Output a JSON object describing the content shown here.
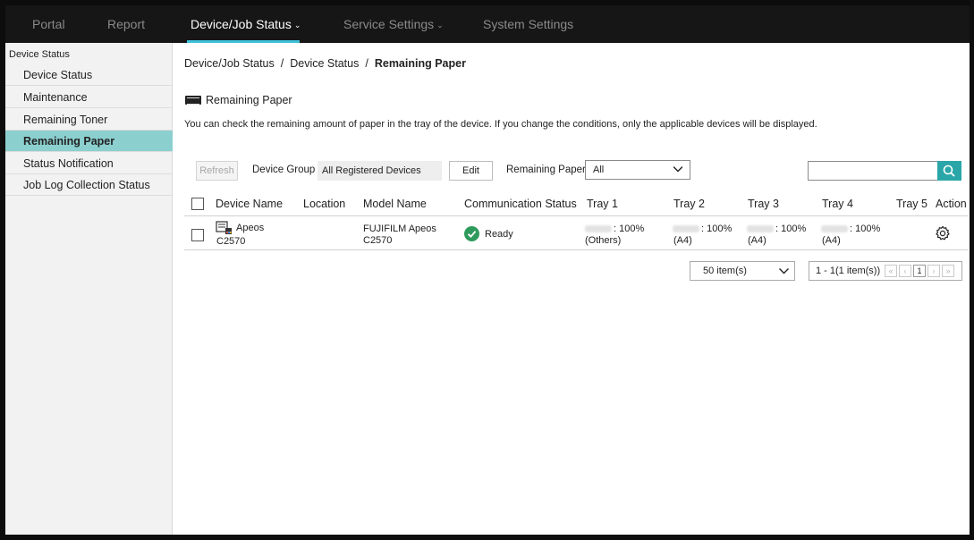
{
  "nav": {
    "items": [
      {
        "label": "Portal",
        "active": false
      },
      {
        "label": "Report",
        "active": false
      },
      {
        "label": "Device/Job Status",
        "active": true,
        "dropdown": true
      },
      {
        "label": "Service Settings",
        "active": false,
        "dropdown": true
      },
      {
        "label": "System Settings",
        "active": false
      }
    ]
  },
  "sidebar": {
    "group_label": "Device Status",
    "items": [
      {
        "label": "Device Status"
      },
      {
        "label": "Maintenance"
      },
      {
        "label": "Remaining Toner"
      },
      {
        "label": "Remaining Paper",
        "active": true
      },
      {
        "label": "Status Notification"
      },
      {
        "label": "Job Log Collection Status"
      }
    ]
  },
  "breadcrumb": {
    "part1": "Device/Job Status",
    "part2": "Device Status",
    "current": "Remaining Paper",
    "sep": "/"
  },
  "page": {
    "title": "Remaining Paper",
    "description": "You can check the remaining amount of paper in the tray of the device. If you change the conditions, only the applicable devices will be displayed."
  },
  "filter": {
    "refresh_label": "Refresh",
    "device_group_label": "Device Group",
    "device_group_value": "All Registered Devices",
    "edit_label": "Edit",
    "remaining_paper_label": "Remaining Paper",
    "remaining_paper_value": "All",
    "search_placeholder": ""
  },
  "table": {
    "headers": {
      "device_name": "Device Name",
      "location": "Location",
      "model_name": "Model Name",
      "comm_status": "Communication Status",
      "tray1": "Tray 1",
      "tray2": "Tray 2",
      "tray3": "Tray 3",
      "tray4": "Tray 4",
      "tray5": "Tray 5",
      "action": "Action"
    },
    "rows": [
      {
        "device_name_line1": "Apeos",
        "device_name_line2": "C2570",
        "location": "",
        "model_line1": "FUJIFILM Apeos",
        "model_line2": "C2570",
        "status": "Ready",
        "tray1_pct": ": 100%",
        "tray1_size": "(Others)",
        "tray2_pct": ": 100%",
        "tray2_size": "(A4)",
        "tray3_pct": ": 100%",
        "tray3_size": "(A4)",
        "tray4_pct": ": 100%",
        "tray4_size": "(A4)",
        "tray5": ""
      }
    ]
  },
  "pagination": {
    "per_page": "50 item(s)",
    "range": "1 - 1(1 item(s))",
    "current_page": "1",
    "first": "«",
    "prev": "‹",
    "next": "›",
    "last": "»"
  },
  "colors": {
    "nav_bg": "#161616",
    "accent": "#3fc0d8",
    "sidebar_active": "#8ccfcf",
    "search_button": "#2aa6a8",
    "ready": "#2e9a5c"
  }
}
